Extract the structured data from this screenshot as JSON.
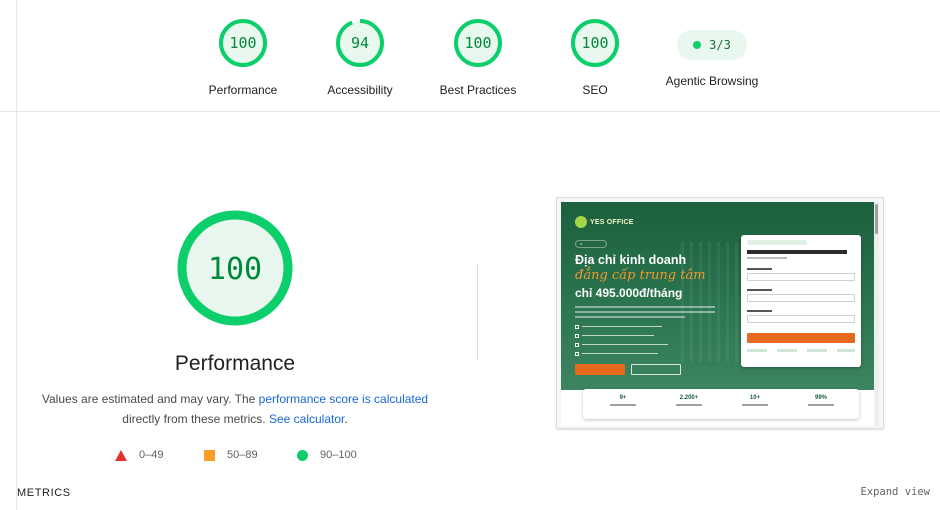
{
  "categories": [
    {
      "label": "Performance",
      "score": 100
    },
    {
      "label": "Accessibility",
      "score": 94
    },
    {
      "label": "Best Practices",
      "score": 100
    },
    {
      "label": "SEO",
      "score": 100
    }
  ],
  "agentic": {
    "label": "Agentic Browsing",
    "value": "3/3"
  },
  "performance": {
    "score": 100,
    "title": "Performance",
    "desc_prefix": "Values are estimated and may vary. The ",
    "desc_link1": "performance score is calculated",
    "desc_mid": "directly from these metrics.",
    "desc_link2": "See calculator",
    "desc_suffix": "."
  },
  "legend": [
    {
      "range": "0–49",
      "shape": "triangle",
      "color": "#e0322c"
    },
    {
      "range": "50–89",
      "shape": "square",
      "color": "#fa9e29"
    },
    {
      "range": "90–100",
      "shape": "circle",
      "color": "#0cce6b"
    }
  ],
  "thumbnail": {
    "logo": "YES OFFICE",
    "headline1": "Địa chỉ kinh doanh",
    "headline2": "đẳng cấp trung tâm",
    "headline3": "chỉ 495.000đ/tháng",
    "stats": [
      "9+",
      "2.200+",
      "10+",
      "99%"
    ]
  },
  "metrics": {
    "title": "METRICS",
    "expand": "Expand view"
  },
  "colors": {
    "pass": "#0cce6b",
    "pass_text": "#008a38",
    "pass_fill": "#e9f8ef",
    "average": "#fa9e29",
    "fail": "#e0322c"
  }
}
